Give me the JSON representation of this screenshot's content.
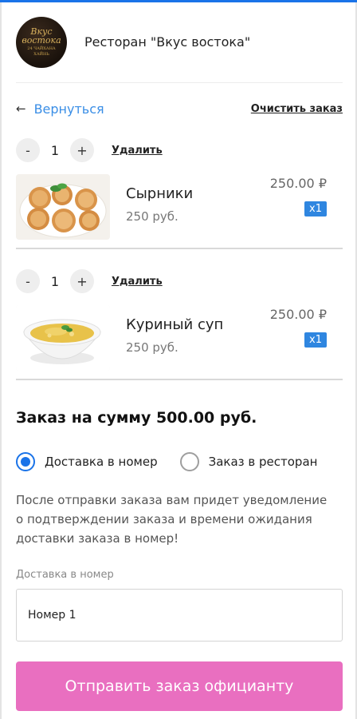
{
  "header": {
    "logo_line1": "Вкус",
    "logo_line2": "востока",
    "logo_line3": "24 ЧАЙХАНА",
    "logo_line4": "ХАЙНЬ",
    "restaurant_name": "Ресторан \"Вкус востока\""
  },
  "nav": {
    "back_arrow": "←",
    "back_label": "Вернуться",
    "clear_label": "Очистить заказ"
  },
  "cart": {
    "minus_label": "-",
    "plus_label": "+",
    "remove_label": "Удалить",
    "items": [
      {
        "quantity": "1",
        "name": "Сырники",
        "unit_price": "250 руб.",
        "price": "250.00 ₽",
        "badge": "x1",
        "image_icon": "syrniki-photo"
      },
      {
        "quantity": "1",
        "name": "Куриный суп",
        "unit_price": "250 руб.",
        "price": "250.00 ₽",
        "badge": "x1",
        "image_icon": "soup-photo"
      }
    ]
  },
  "order": {
    "summary": "Заказ на сумму 500.00 руб.",
    "options": [
      {
        "label": "Доставка в номер",
        "selected": true
      },
      {
        "label": "Заказ в ресторан",
        "selected": false
      }
    ],
    "notice": "После отправки заказа вам придет уведомление о подтверждении заказа и времени ожидания доставки заказа в номер!",
    "field_label": "Доставка в номер",
    "room_value": "Номер 1",
    "submit_label": "Отправить заказ официанту"
  },
  "colors": {
    "accent": "#1a73e8",
    "link": "#3a8ee6",
    "badge": "#2f86e0",
    "submit": "#e96fc0"
  }
}
